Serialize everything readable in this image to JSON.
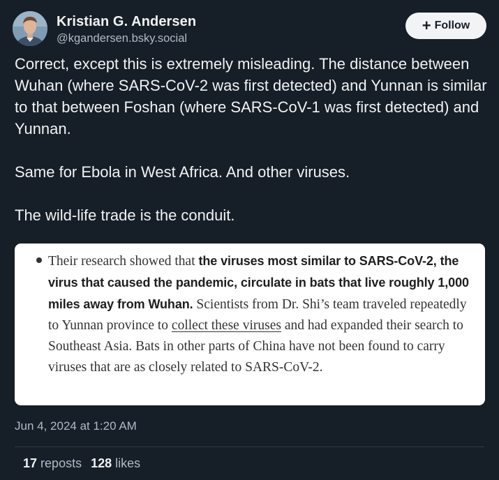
{
  "author": {
    "name": "Kristian G. Andersen",
    "handle": "@kgandersen.bsky.social",
    "avatar_icon": "user-photo-icon"
  },
  "follow_button": {
    "label": "Follow",
    "icon": "plus-icon"
  },
  "post": {
    "text": "Correct, except this is extremely misleading. The distance between Wuhan (where SARS-CoV-2 was first detected) and Yunnan is similar to that between Foshan (where SARS-CoV-1 was first detected) and Yunnan.\n\nSame for Ebola in West Africa. And other viruses.\n\nThe wild-life trade is the conduit."
  },
  "embed": {
    "text_before_bold": "Their research showed that ",
    "bold_text": "the viruses most similar to SARS-CoV-2, the virus that caused the pandemic, circulate in bats that live roughly 1,000 miles away from Wuhan.",
    "text_after_bold": " Scientists from Dr. Shi’s team traveled repeatedly to Yunnan province to ",
    "link_text": "collect these viruses",
    "text_end": " and had expanded their search to Southeast Asia. Bats in other parts of China have not been found to carry viruses that are as closely related to SARS-CoV-2."
  },
  "timestamp": "Jun 4, 2024 at 1:20 AM",
  "stats": {
    "reposts_count": "17",
    "reposts_label": "reposts",
    "likes_count": "128",
    "likes_label": "likes"
  },
  "colors": {
    "background": "#161e27",
    "text": "#f1f3f5",
    "muted": "#aebbc9"
  }
}
